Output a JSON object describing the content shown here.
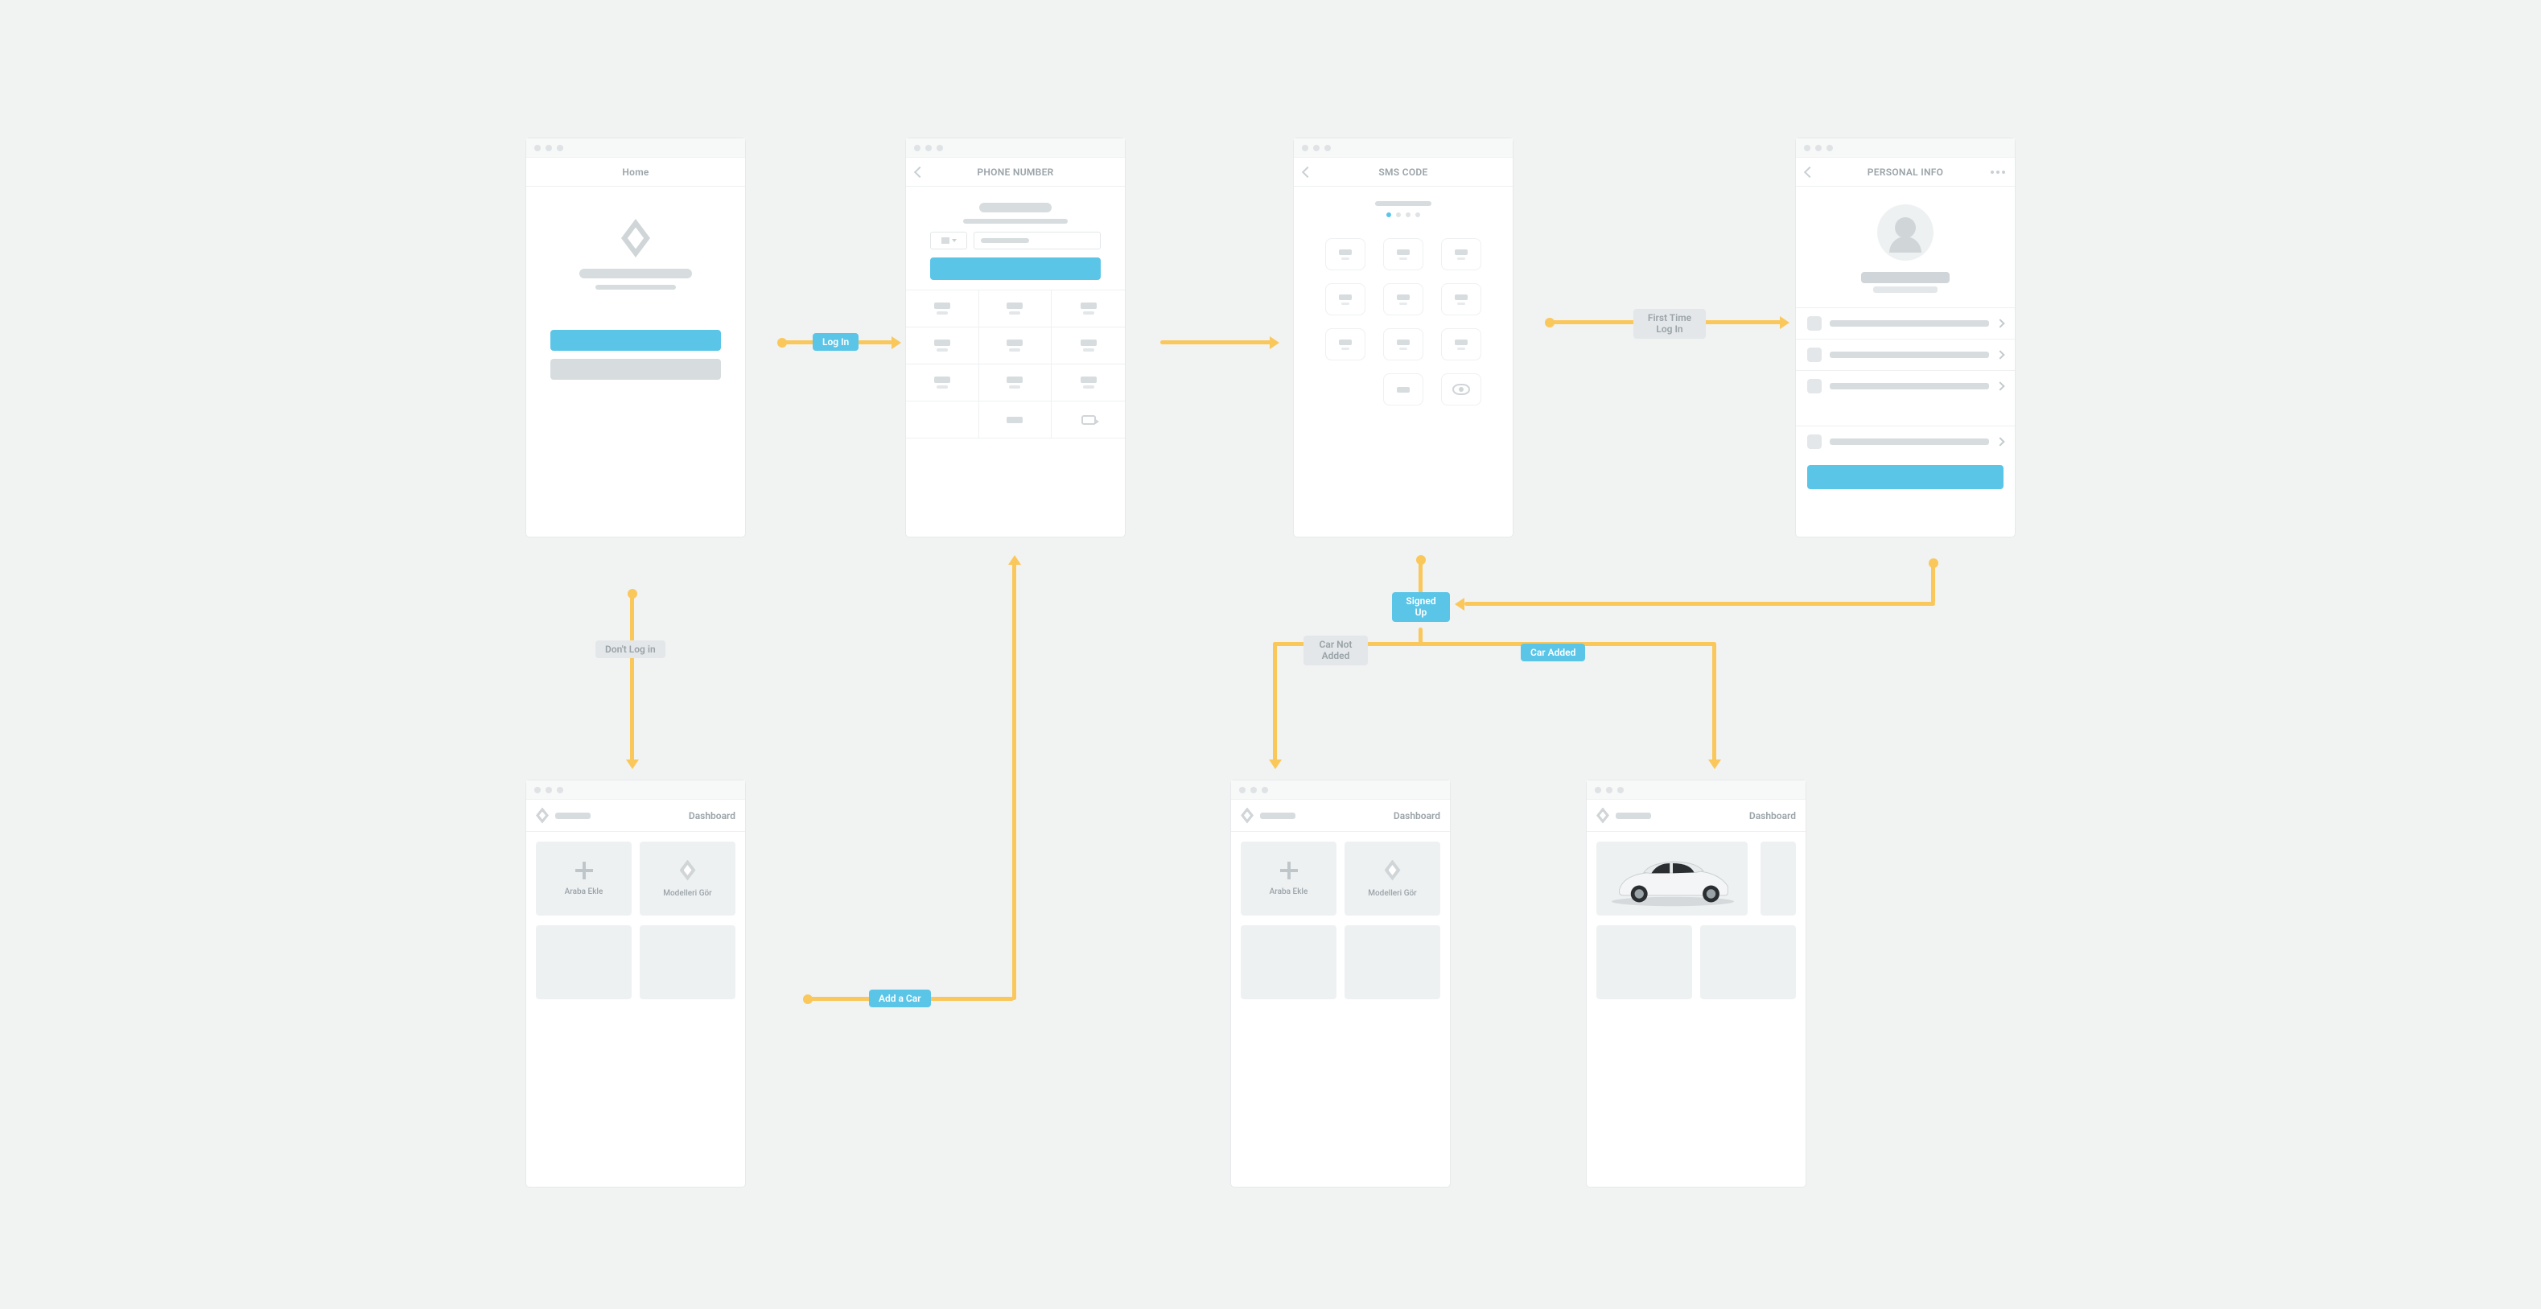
{
  "screens": {
    "home": {
      "title": "Home"
    },
    "phone": {
      "title": "PHONE NUMBER"
    },
    "sms": {
      "title": "SMS CODE"
    },
    "personal": {
      "title": "PERSONAL INFO"
    },
    "dashboard": {
      "title": "Dashboard"
    }
  },
  "dashboard_cards": {
    "add": "Araba Ekle",
    "models": "Modelleri Gör"
  },
  "flow_labels": {
    "login": "Log In",
    "dont_login": "Don't Log in",
    "first_time": "First Time\nLog In",
    "signed_up": "Signed\nUp",
    "car_not_added": "Car Not\nAdded",
    "car_added": "Car Added",
    "add_a_car": "Add a Car"
  }
}
